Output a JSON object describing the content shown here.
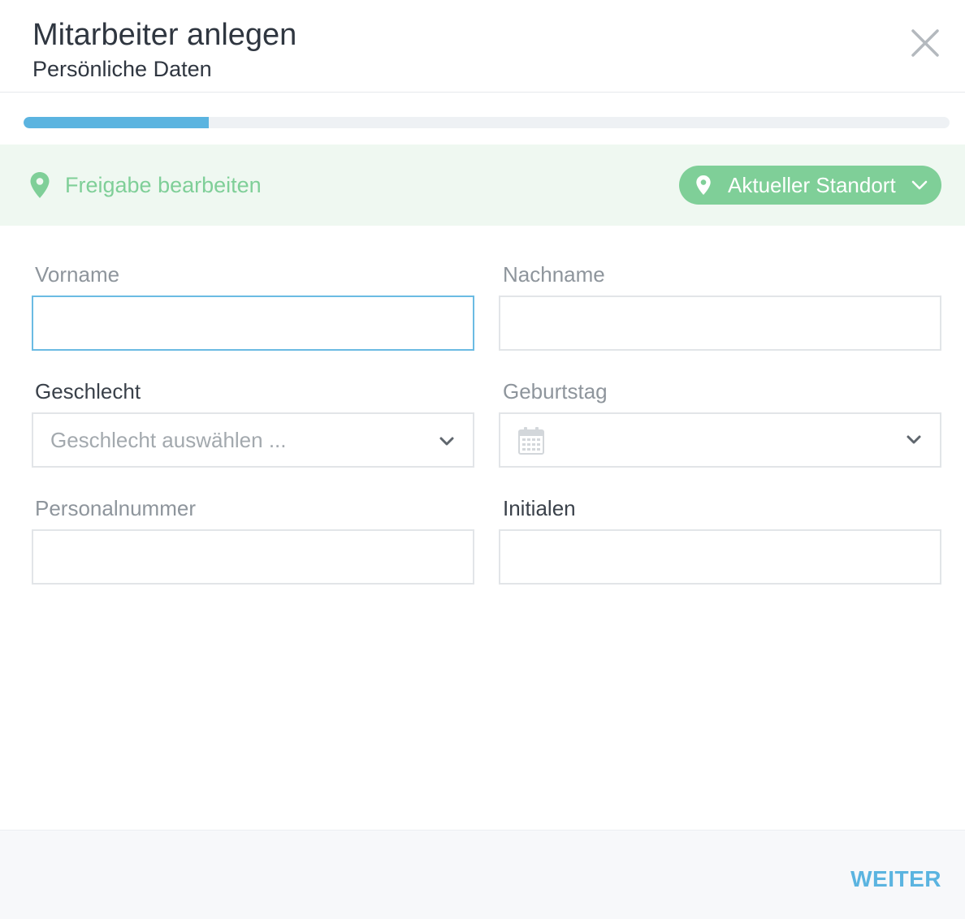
{
  "header": {
    "title": "Mitarbeiter anlegen",
    "subtitle": "Persönliche Daten"
  },
  "progress": {
    "value_percent": 20
  },
  "location": {
    "link_label": "Freigabe bearbeiten",
    "selector_label": "Aktueller Standort",
    "accent_color": "#7fcf98"
  },
  "form": {
    "first_name": {
      "label": "Vorname",
      "value": "",
      "placeholder": ""
    },
    "last_name": {
      "label": "Nachname",
      "value": "",
      "placeholder": ""
    },
    "gender": {
      "label": "Geschlecht",
      "placeholder": "Geschlecht auswählen ..."
    },
    "birthday": {
      "label": "Geburtstag",
      "value": ""
    },
    "personnel_number": {
      "label": "Personalnummer",
      "value": ""
    },
    "initials": {
      "label": "Initialen",
      "value": ""
    }
  },
  "footer": {
    "next_label": "WEITER"
  },
  "colors": {
    "primary": "#5bb4e0",
    "success": "#7fcf98",
    "text": "#2f3640"
  },
  "icons": {
    "close": "close-icon",
    "location": "map-pin-icon",
    "dropdown": "chevron-down-icon",
    "calendar": "calendar-icon"
  }
}
